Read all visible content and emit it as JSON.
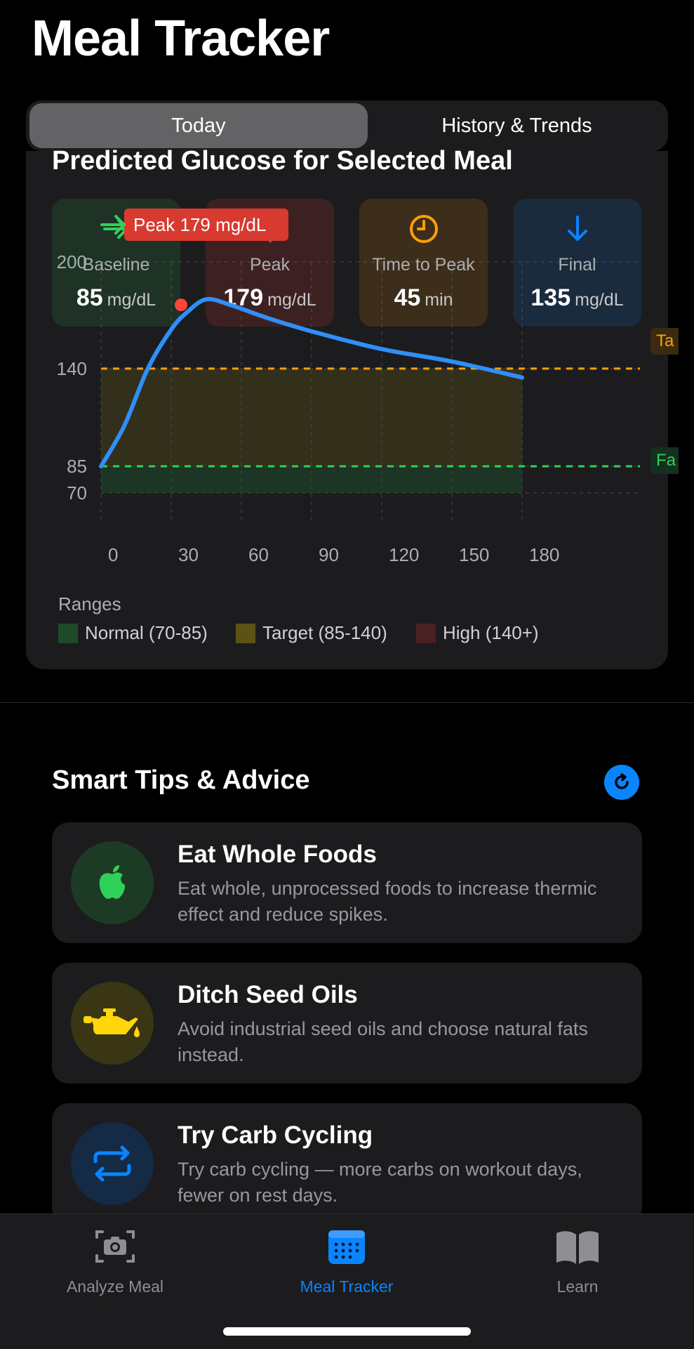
{
  "app": {
    "title": "Meal Tracker"
  },
  "segments": {
    "today": "Today",
    "history": "History & Trends"
  },
  "chart": {
    "title": "Predicted Glucose for Selected Meal",
    "peak_callout": "Peak 179 mg/dL",
    "target_line_label": "Ta",
    "fasting_line_label": "Fa",
    "stats": [
      {
        "label": "Baseline",
        "value": "85",
        "unit": "mg/dL",
        "icon": "arrow-right-icon",
        "color": "#30d158"
      },
      {
        "label": "Peak",
        "value": "179",
        "unit": "mg/dL",
        "icon": "arrow-up-icon",
        "color": "#ff453a"
      },
      {
        "label": "Time to Peak",
        "value": "45",
        "unit": "min",
        "icon": "clock-icon",
        "color": "#ff9f0a"
      },
      {
        "label": "Final",
        "value": "135",
        "unit": "mg/dL",
        "icon": "arrow-down-icon",
        "color": "#0a84ff"
      }
    ],
    "legend": {
      "title": "Ranges",
      "items": [
        {
          "label": "Normal (70-85)",
          "color": "#1f4a2a"
        },
        {
          "label": "Target (85-140)",
          "color": "#5c5218"
        },
        {
          "label": "High (140+)",
          "color": "#4a2023"
        }
      ]
    }
  },
  "chart_data": {
    "type": "line",
    "x": [
      0,
      10,
      20,
      30,
      37,
      45,
      55,
      70,
      90,
      120,
      150,
      180
    ],
    "series": [
      {
        "values": [
          85,
          108,
          140,
          162,
          172,
          179,
          176,
          169,
          161,
          151,
          144,
          135
        ]
      }
    ],
    "xticks": [
      "0",
      "30",
      "60",
      "90",
      "120",
      "150",
      "180"
    ],
    "yticks": [
      "70",
      "85",
      "140",
      "200"
    ],
    "xlim": [
      0,
      240
    ],
    "ylim": [
      55,
      200
    ],
    "reference_lines": [
      {
        "y": 140,
        "label": "Ta",
        "color": "#ff9f0a"
      },
      {
        "y": 85,
        "label": "Fa",
        "color": "#30d158"
      }
    ],
    "bands": [
      {
        "from": 70,
        "to": 85,
        "label": "Normal (70-85)",
        "color": "#1f4a2a"
      },
      {
        "from": 85,
        "to": 140,
        "label": "Target (85-140)",
        "color": "#5c5218"
      },
      {
        "from": 140,
        "to": 200,
        "label": "High (140+)",
        "color": "#4a2023"
      }
    ],
    "peak": {
      "x": 45,
      "y": 179
    },
    "grid": true,
    "line_color": "#2f8ff8"
  },
  "tips": {
    "title": "Smart Tips & Advice",
    "items": [
      {
        "title": "Eat Whole Foods",
        "description": "Eat whole, unprocessed foods to increase thermic effect and reduce spikes.",
        "icon": "apple-icon",
        "color": "#30d158"
      },
      {
        "title": "Ditch Seed Oils",
        "description": "Avoid industrial seed oils and choose natural fats instead.",
        "icon": "oil-can-icon",
        "color": "#ffd60a"
      },
      {
        "title": "Try Carb Cycling",
        "description": "Try carb cycling — more carbs on workout days, fewer on rest days.",
        "icon": "cycle-arrows-icon",
        "color": "#0a84ff"
      }
    ]
  },
  "tabbar": {
    "items": [
      {
        "label": "Analyze Meal",
        "icon": "camera-icon",
        "active": false
      },
      {
        "label": "Meal Tracker",
        "icon": "calendar-icon",
        "active": true
      },
      {
        "label": "Learn",
        "icon": "book-icon",
        "active": false
      }
    ]
  }
}
